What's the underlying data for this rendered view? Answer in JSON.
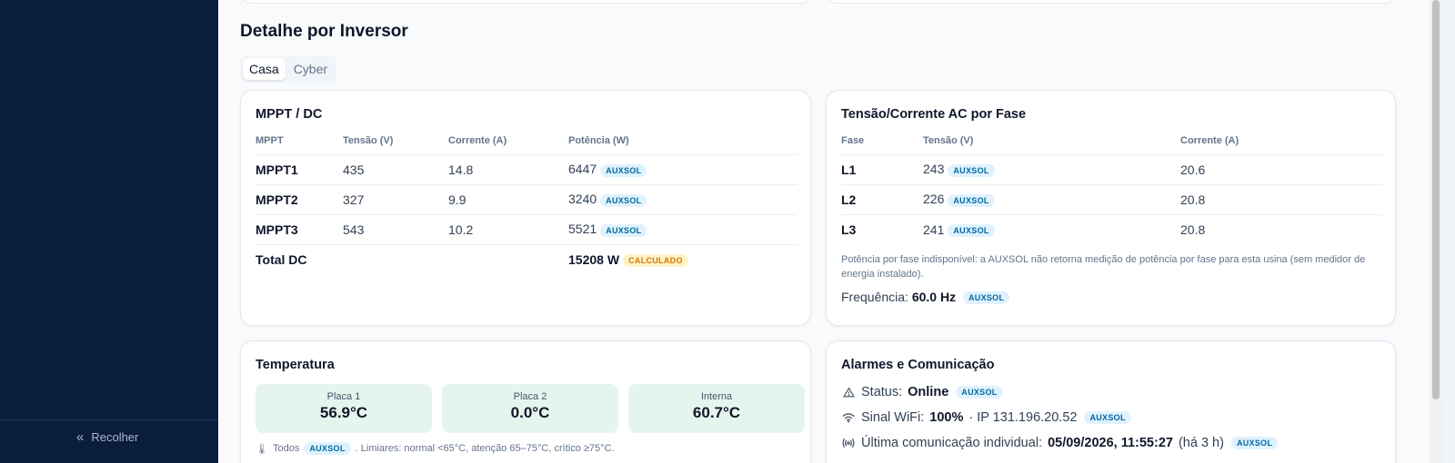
{
  "sidebar": {
    "collapse_label": "Recolher"
  },
  "section": {
    "title": "Detalhe por Inversor"
  },
  "tabs": [
    {
      "label": "Casa",
      "active": true
    },
    {
      "label": "Cyber",
      "active": false
    }
  ],
  "mppt": {
    "title": "MPPT / DC",
    "headers": [
      "MPPT",
      "Tensão (V)",
      "Corrente (A)",
      "Potência (W)"
    ],
    "rows": [
      {
        "name": "MPPT1",
        "voltage": "435",
        "current": "14.8",
        "power": "6447",
        "badge": "AUXSOL"
      },
      {
        "name": "MPPT2",
        "voltage": "327",
        "current": "9.9",
        "power": "3240",
        "badge": "AUXSOL"
      },
      {
        "name": "MPPT3",
        "voltage": "543",
        "current": "10.2",
        "power": "5521",
        "badge": "AUXSOL"
      }
    ],
    "total": {
      "label": "Total DC",
      "power": "15208 W",
      "badge": "CALCULADO"
    }
  },
  "ac": {
    "title": "Tensão/Corrente AC por Fase",
    "headers": [
      "Fase",
      "Tensão (V)",
      "Corrente (A)"
    ],
    "rows": [
      {
        "phase": "L1",
        "voltage": "243",
        "badge": "AUXSOL",
        "current": "20.6"
      },
      {
        "phase": "L2",
        "voltage": "226",
        "badge": "AUXSOL",
        "current": "20.8"
      },
      {
        "phase": "L3",
        "voltage": "241",
        "badge": "AUXSOL",
        "current": "20.8"
      }
    ],
    "note": "Potência por fase indisponível: a AUXSOL não retorna medição de potência por fase para esta usina (sem medidor de energia instalado).",
    "freq_label": "Frequência:",
    "freq_value": "60.0 Hz",
    "freq_badge": "AUXSOL"
  },
  "temperature": {
    "title": "Temperatura",
    "boxes": [
      {
        "label": "Placa 1",
        "value": "56.9°C"
      },
      {
        "label": "Placa 2",
        "value": "0.0°C"
      },
      {
        "label": "Interna",
        "value": "60.7°C"
      }
    ],
    "note_prefix": "Todos",
    "note_badge": "AUXSOL",
    "note_text": ". Limiares: normal <65°C, atenção 65–75°C, crítico ≥75°C."
  },
  "alarms": {
    "title": "Alarmes e Comunicação",
    "status_label": "Status:",
    "status_value": "Online",
    "status_badge": "AUXSOL",
    "wifi_label": "Sinal WiFi:",
    "wifi_value": "100%",
    "wifi_ip": "· IP 131.196.20.52",
    "wifi_badge": "AUXSOL",
    "comm_label": "Última comunicação individual:",
    "comm_value": "05/09/2026, 11:55:27",
    "comm_ago": "(há 3 h)",
    "comm_badge": "AUXSOL"
  },
  "icons": {
    "collapse": "chevrons-left-icon",
    "thermometer": "thermometer-icon",
    "status": "alert-triangle-icon",
    "wifi": "wifi-icon",
    "comm": "radio-icon"
  },
  "colors": {
    "sidebar": "#0b1d3d",
    "badge_bg": "#e0f2fe",
    "badge_fg": "#0369a1",
    "calc_bg": "#fef3c7",
    "calc_fg": "#d97706",
    "temp_box": "#e6f4ee"
  }
}
